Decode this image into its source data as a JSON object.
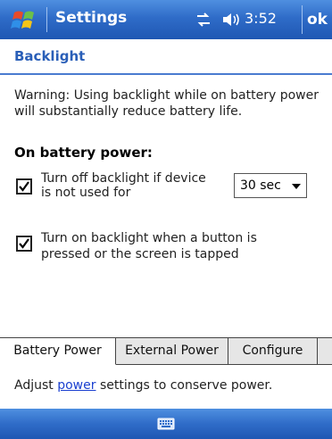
{
  "window": {
    "title": "Settings",
    "clock": "3:52",
    "ok_label": "ok"
  },
  "heading": "Backlight",
  "warning": "Warning: Using backlight while on battery power will substantially reduce battery life.",
  "section_label": "On battery power:",
  "options": [
    {
      "label": "Turn off backlight if device is not used for",
      "checked": true
    },
    {
      "label": "Turn on backlight when a button is pressed or the screen is tapped",
      "checked": true
    }
  ],
  "timeout_select": {
    "value": "30 sec"
  },
  "tabs": [
    {
      "label": "Battery Power",
      "active": true
    },
    {
      "label": "External Power",
      "active": false
    },
    {
      "label": "Configure",
      "active": false
    }
  ],
  "footer": {
    "prefix": "Adjust ",
    "link": "power",
    "suffix": " settings to conserve power."
  },
  "icons": {
    "start": "windows-flag-icon",
    "connectivity": "connectivity-icon",
    "volume": "volume-icon",
    "keyboard": "keyboard-icon"
  },
  "colors": {
    "titlebar": "#2f6cc8",
    "heading": "#2a5fb8",
    "link": "#1a3fd0"
  }
}
